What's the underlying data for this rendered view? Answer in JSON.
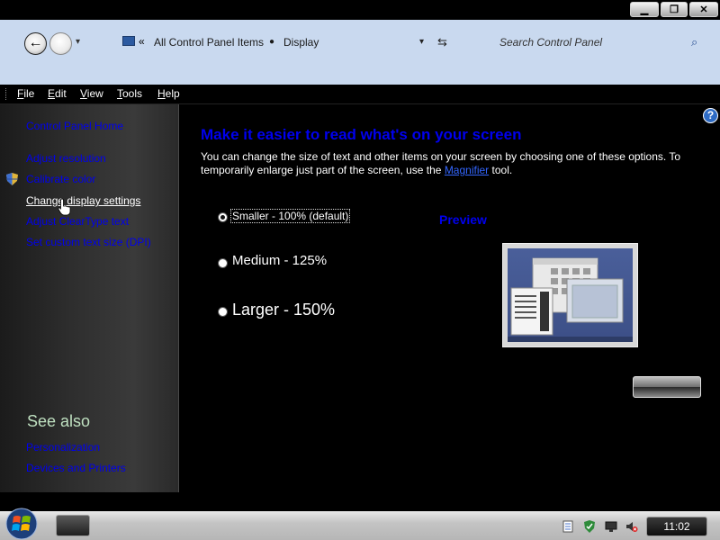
{
  "window": {
    "minimize_glyph": "▁",
    "maximize_glyph": "❐",
    "close_glyph": "✕"
  },
  "navigation": {
    "back_glyph": "←",
    "breadcrumb_root_glyph": "«",
    "breadcrumbs": [
      "All Control Panel Items",
      "Display"
    ],
    "breadcrumb_separator": "●",
    "dropdown_glyph": "▾",
    "refresh_glyph": "⇆",
    "search_placeholder": "Search Control Panel",
    "search_glyph": "⌕"
  },
  "menu": {
    "items": [
      "File",
      "Edit",
      "View",
      "Tools",
      "Help"
    ]
  },
  "left_pane": {
    "links": [
      "Control Panel Home",
      "Adjust resolution",
      "Calibrate color",
      "Change display settings",
      "Adjust ClearType text",
      "Set custom text size (DPI)"
    ],
    "see_also_title": "See also",
    "see_also_links": [
      "Personalization",
      "Devices and Printers"
    ]
  },
  "main": {
    "title": "Make it easier to read what's on your screen",
    "description_part1": "You can change the size of text and other items on your screen by choosing one of these options. To temporarily enlarge just part of the screen, use the ",
    "magnifier_link": "Magnifier",
    "description_part2": " tool.",
    "options": [
      {
        "label": "Smaller - 100% (default)",
        "selected": true
      },
      {
        "label": "Medium - 125%",
        "selected": false
      },
      {
        "label": "Larger - 150%",
        "selected": false
      }
    ],
    "preview_label": "Preview",
    "help_glyph": "?"
  },
  "taskbar": {
    "clock": "11:02"
  },
  "colors": {
    "link": "#0000ee",
    "navbar": "#c9d9ef",
    "see_also": "#bfe0c0"
  }
}
